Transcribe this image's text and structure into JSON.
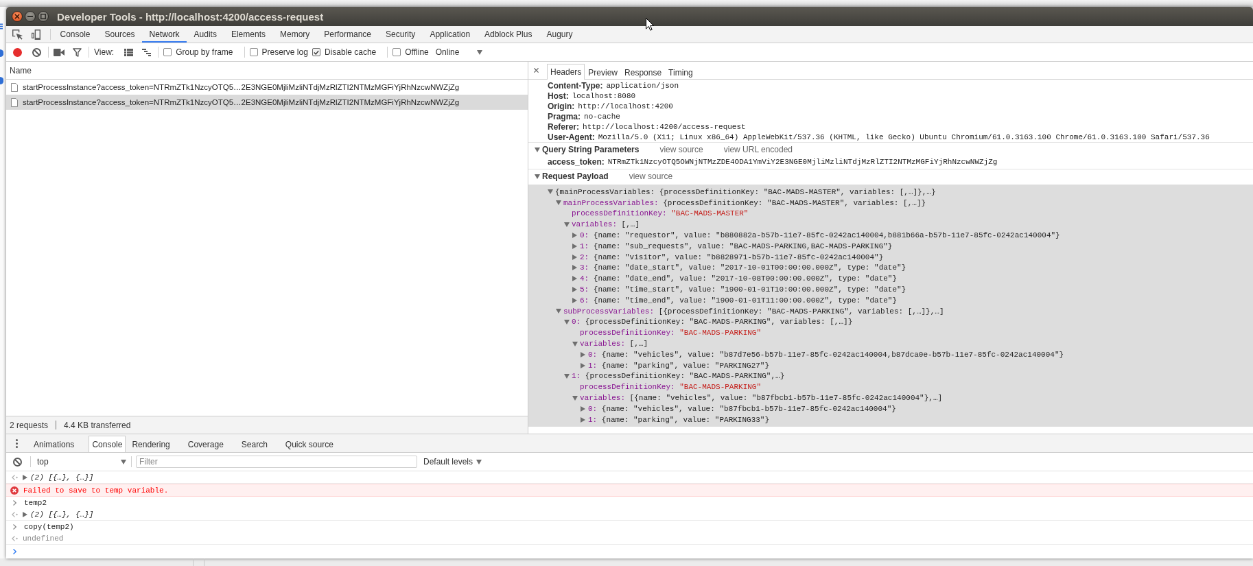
{
  "window": {
    "title": "Developer Tools - http://localhost:4200/access-request"
  },
  "main_tabs": [
    {
      "label": "Console",
      "selected": false
    },
    {
      "label": "Sources",
      "selected": false
    },
    {
      "label": "Network",
      "selected": true
    },
    {
      "label": "Audits",
      "selected": false
    },
    {
      "label": "Elements",
      "selected": false
    },
    {
      "label": "Memory",
      "selected": false
    },
    {
      "label": "Performance",
      "selected": false
    },
    {
      "label": "Security",
      "selected": false
    },
    {
      "label": "Application",
      "selected": false
    },
    {
      "label": "Adblock Plus",
      "selected": false
    },
    {
      "label": "Augury",
      "selected": false
    }
  ],
  "network_toolbar": {
    "recording": true,
    "view_label": "View:",
    "option_groups": [
      [
        {
          "label": "Group by frame",
          "checked": false
        }
      ],
      [
        {
          "label": "Preserve log",
          "checked": false
        },
        {
          "label": "Disable cache",
          "checked": true
        }
      ],
      [
        {
          "label": "Offline",
          "checked": false
        }
      ]
    ],
    "throttling": "Online"
  },
  "requests": {
    "column": "Name",
    "rows": [
      {
        "name": "startProcessInstance?access_token=NTRmZTk1NzcyOTQ5…2E3NGE0MjliMzliNTdjMzRlZTI2NTMzMGFiYjRhNzcwNWZjZg",
        "selected": false
      },
      {
        "name": "startProcessInstance?access_token=NTRmZTk1NzcyOTQ5…2E3NGE0MjliMzliNTdjMzRlZTI2NTMzMGFiYjRhNzcwNWZjZg",
        "selected": true
      }
    ],
    "summary": [
      "2 requests",
      "4.4 KB transferred"
    ]
  },
  "detail": {
    "tabs": [
      {
        "label": "Headers",
        "selected": true
      },
      {
        "label": "Preview",
        "selected": false
      },
      {
        "label": "Response",
        "selected": false
      },
      {
        "label": "Timing",
        "selected": false
      }
    ],
    "headers": [
      {
        "name": "Content-Type:",
        "value": "application/json"
      },
      {
        "name": "Host:",
        "value": "localhost:8080"
      },
      {
        "name": "Origin:",
        "value": "http://localhost:4200"
      },
      {
        "name": "Pragma:",
        "value": "no-cache"
      },
      {
        "name": "Referer:",
        "value": "http://localhost:4200/access-request"
      },
      {
        "name": "User-Agent:",
        "value": "Mozilla/5.0 (X11; Linux x86_64) AppleWebKit/537.36 (KHTML, like Gecko) Ubuntu Chromium/61.0.3163.100 Chrome/61.0.3163.100 Safari/537.36"
      }
    ],
    "query": {
      "title": "Query String Parameters",
      "expanded": true,
      "links": [
        "view source",
        "view URL encoded"
      ],
      "params": [
        {
          "name": "access_token:",
          "value": "NTRmZTk1NzcyOTQ5OWNjNTMzZDE4ODA1YmViY2E3NGE0MjliMzliNTdjMzRlZTI2NTMzMGFiYjRhNzcwNWZjZg"
        }
      ]
    },
    "payload": {
      "title": "Request Payload",
      "expanded": true,
      "links": [
        "view source"
      ],
      "tree": {
        "kind": "object",
        "summary": "{mainProcessVariables: {processDefinitionKey: \"BAC-MADS-MASTER\", variables: [,…]},…}",
        "expanded": true,
        "children": [
          {
            "kind": "object",
            "key": "mainProcessVariables:",
            "summary": "{processDefinitionKey: \"BAC-MADS-MASTER\", variables: [,…]}",
            "expanded": true,
            "children": [
              {
                "kind": "string",
                "key": "processDefinitionKey:",
                "value": "\"BAC-MADS-MASTER\""
              },
              {
                "kind": "object",
                "key": "variables:",
                "summary": "[,…]",
                "expanded": true,
                "children": [
                  {
                    "kind": "object",
                    "key": "0:",
                    "summary": "{name: \"requestor\", value: \"b880882a-b57b-11e7-85fc-0242ac140004,b881b66a-b57b-11e7-85fc-0242ac140004\"}",
                    "expanded": false
                  },
                  {
                    "kind": "object",
                    "key": "1:",
                    "summary": "{name: \"sub_requests\", value: \"BAC-MADS-PARKING,BAC-MADS-PARKING\"}",
                    "expanded": false
                  },
                  {
                    "kind": "object",
                    "key": "2:",
                    "summary": "{name: \"visitor\", value: \"b8828971-b57b-11e7-85fc-0242ac140004\"}",
                    "expanded": false
                  },
                  {
                    "kind": "object",
                    "key": "3:",
                    "summary": "{name: \"date_start\", value: \"2017-10-01T00:00:00.000Z\", type: \"date\"}",
                    "expanded": false
                  },
                  {
                    "kind": "object",
                    "key": "4:",
                    "summary": "{name: \"date_end\", value: \"2017-10-08T00:00:00.000Z\", type: \"date\"}",
                    "expanded": false
                  },
                  {
                    "kind": "object",
                    "key": "5:",
                    "summary": "{name: \"time_start\", value: \"1900-01-01T10:00:00.000Z\", type: \"date\"}",
                    "expanded": false
                  },
                  {
                    "kind": "object",
                    "key": "6:",
                    "summary": "{name: \"time_end\", value: \"1900-01-01T11:00:00.000Z\", type: \"date\"}",
                    "expanded": false
                  }
                ]
              }
            ]
          },
          {
            "kind": "object",
            "key": "subProcessVariables:",
            "summary": "[{processDefinitionKey: \"BAC-MADS-PARKING\", variables: [,…]},…]",
            "expanded": true,
            "children": [
              {
                "kind": "object",
                "key": "0:",
                "summary": "{processDefinitionKey: \"BAC-MADS-PARKING\", variables: [,…]}",
                "expanded": true,
                "children": [
                  {
                    "kind": "string",
                    "key": "processDefinitionKey:",
                    "value": "\"BAC-MADS-PARKING\""
                  },
                  {
                    "kind": "object",
                    "key": "variables:",
                    "summary": "[,…]",
                    "expanded": true,
                    "children": [
                      {
                        "kind": "object",
                        "key": "0:",
                        "summary": "{name: \"vehicles\", value: \"b87d7e56-b57b-11e7-85fc-0242ac140004,b87dca0e-b57b-11e7-85fc-0242ac140004\"}",
                        "expanded": false
                      },
                      {
                        "kind": "object",
                        "key": "1:",
                        "summary": "{name: \"parking\", value: \"PARKING27\"}",
                        "expanded": false
                      }
                    ]
                  }
                ]
              },
              {
                "kind": "object",
                "key": "1:",
                "summary": "{processDefinitionKey: \"BAC-MADS-PARKING\",…}",
                "expanded": true,
                "children": [
                  {
                    "kind": "string",
                    "key": "processDefinitionKey:",
                    "value": "\"BAC-MADS-PARKING\""
                  },
                  {
                    "kind": "object",
                    "key": "variables:",
                    "summary": "[{name: \"vehicles\", value: \"b87fbcb1-b57b-11e7-85fc-0242ac140004\"},…]",
                    "expanded": true,
                    "children": [
                      {
                        "kind": "object",
                        "key": "0:",
                        "summary": "{name: \"vehicles\", value: \"b87fbcb1-b57b-11e7-85fc-0242ac140004\"}",
                        "expanded": false
                      },
                      {
                        "kind": "object",
                        "key": "1:",
                        "summary": "{name: \"parking\", value: \"PARKING33\"}",
                        "expanded": false
                      }
                    ]
                  }
                ]
              }
            ]
          }
        ]
      }
    }
  },
  "drawer": {
    "tabs": [
      {
        "label": "Animations",
        "selected": false
      },
      {
        "label": "Console",
        "selected": true
      },
      {
        "label": "Rendering",
        "selected": false
      },
      {
        "label": "Coverage",
        "selected": false
      },
      {
        "label": "Search",
        "selected": false
      },
      {
        "label": "Quick source",
        "selected": false
      }
    ],
    "context": "top",
    "filter_placeholder": "Filter",
    "levels": "Default levels",
    "messages": [
      {
        "kind": "object_result",
        "text": "(2) [{…}, {…}]",
        "expanded": false
      },
      {
        "kind": "error",
        "text": "Failed to save to temp variable."
      },
      {
        "kind": "command",
        "text": "temp2"
      },
      {
        "kind": "object_result",
        "text": "(2) [{…}, {…}]",
        "expanded": false
      },
      {
        "kind": "command",
        "text": "copy(temp2)"
      },
      {
        "kind": "value_result",
        "text": "undefined"
      }
    ]
  }
}
